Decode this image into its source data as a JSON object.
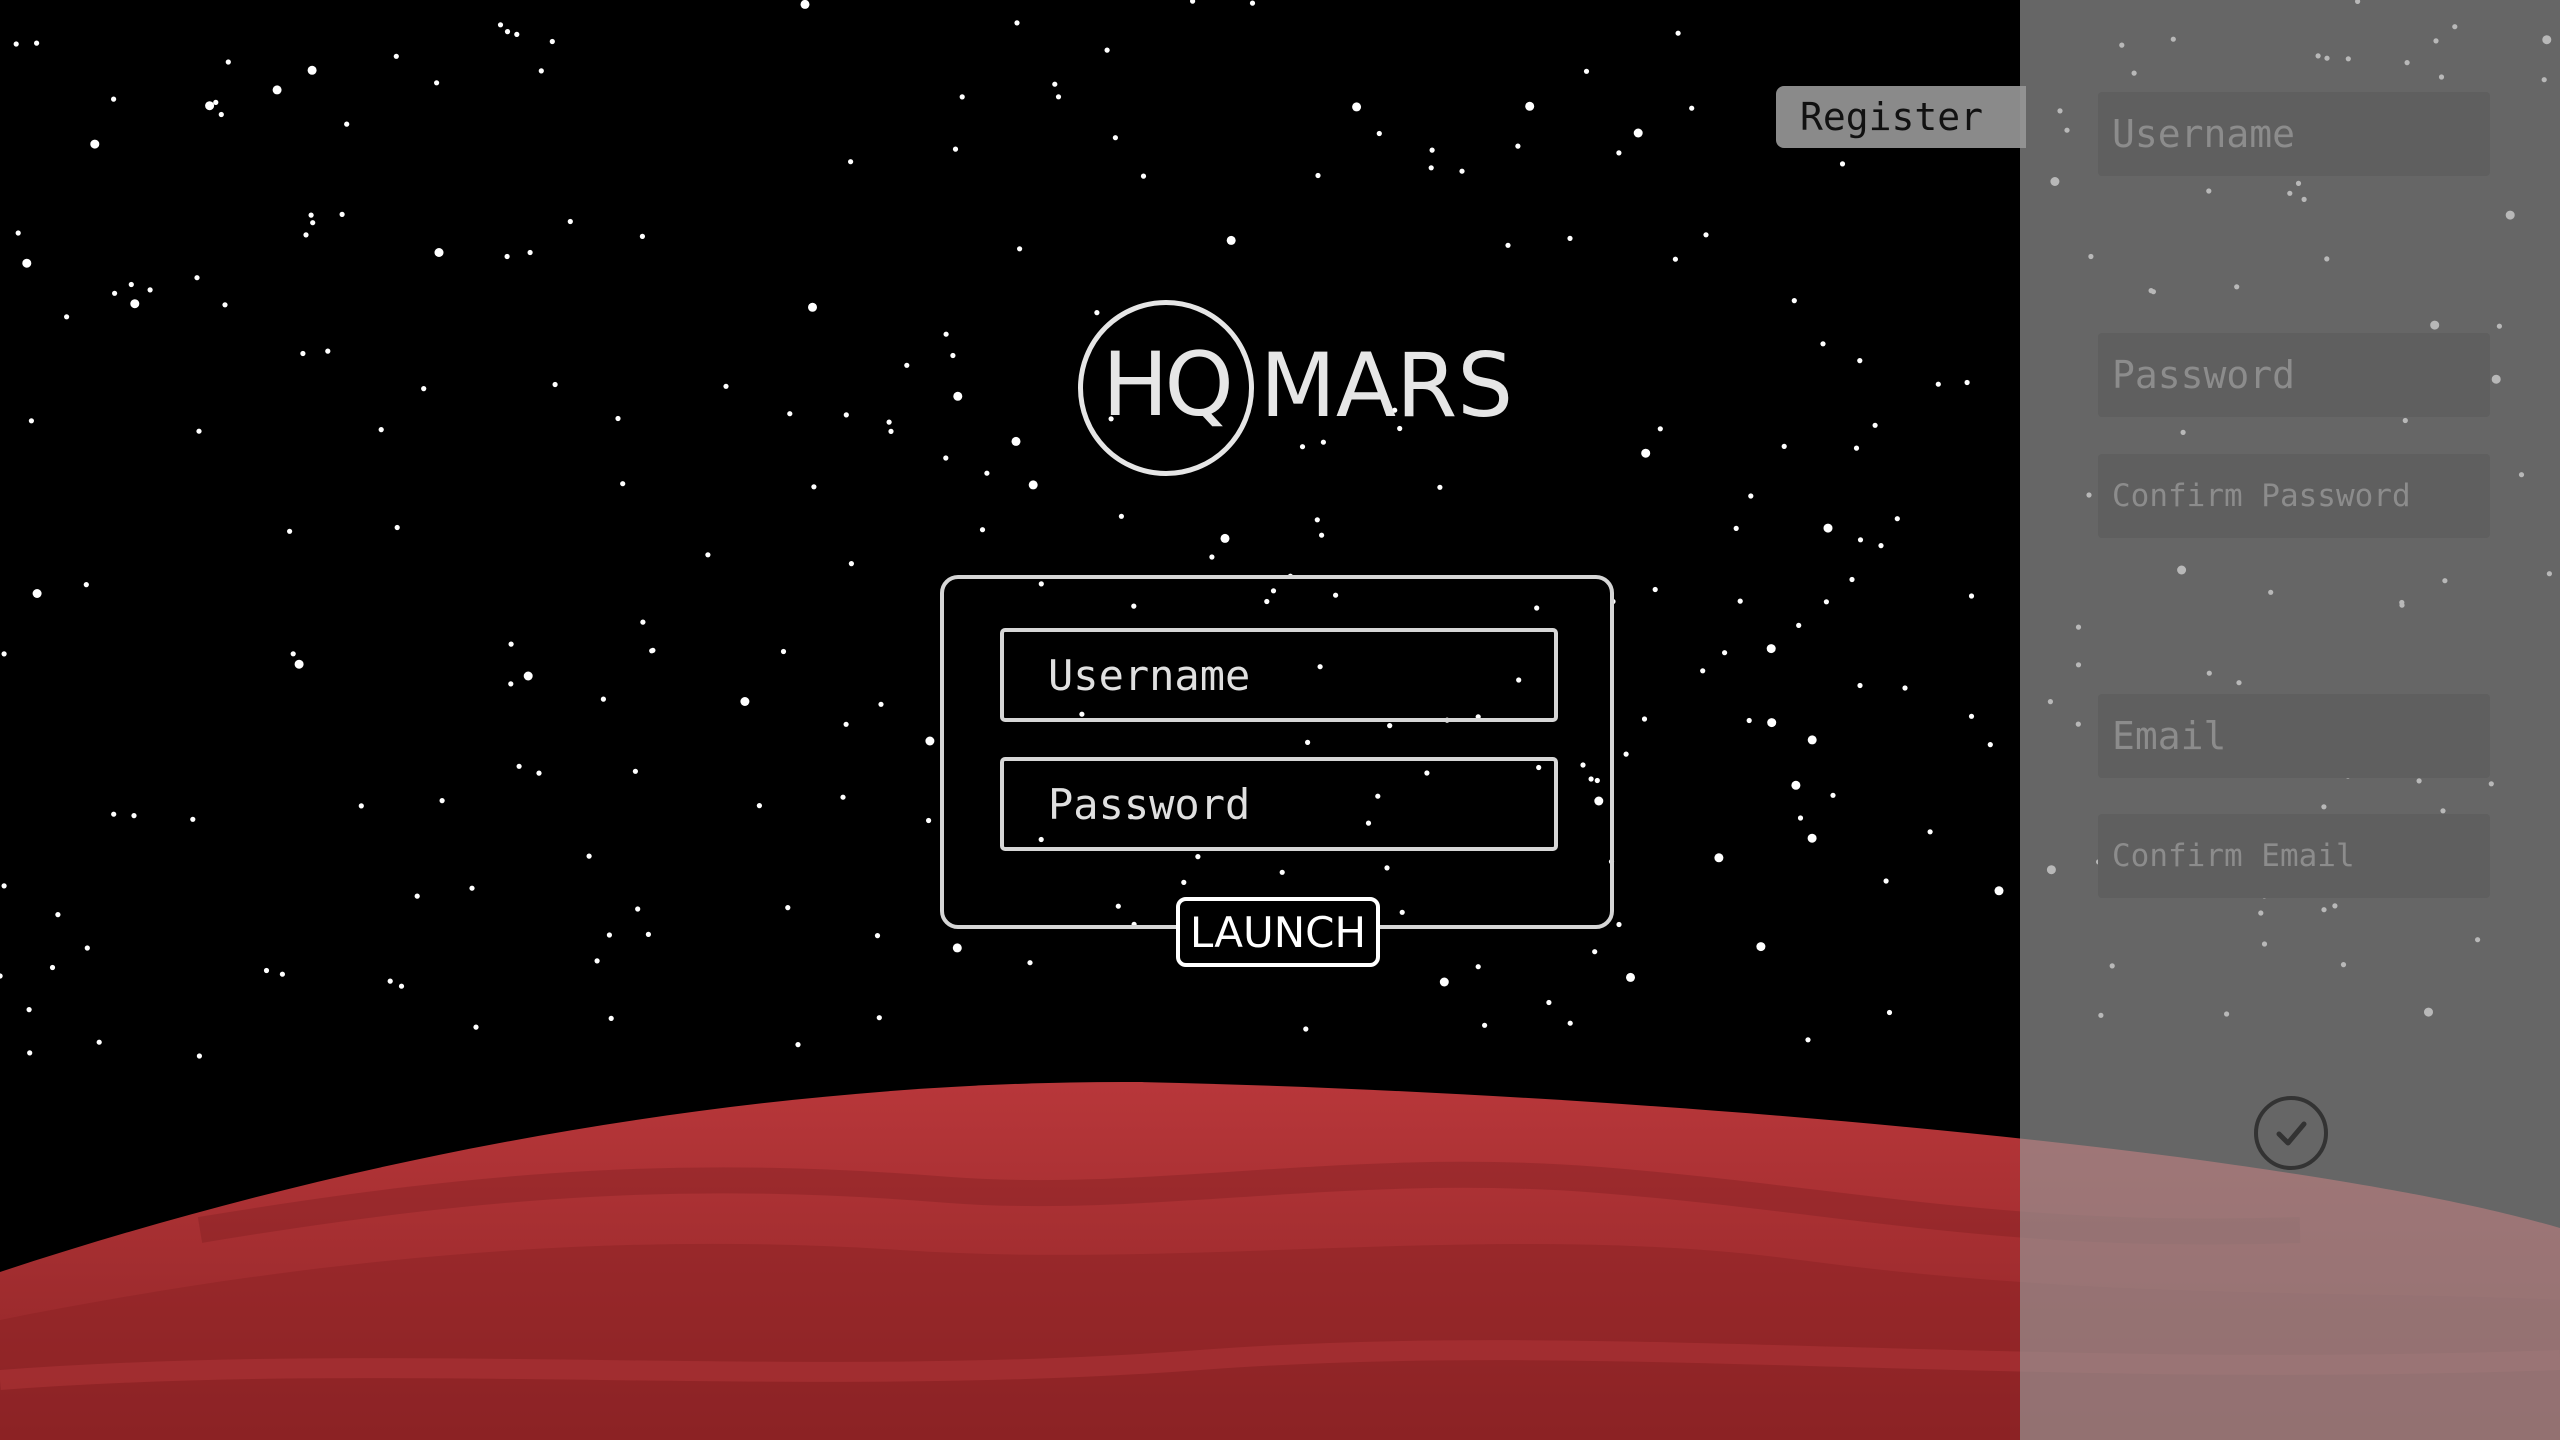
{
  "logo": {
    "hq": "HQ",
    "mars": "MARS"
  },
  "login": {
    "username_placeholder": "Username",
    "password_placeholder": "Password",
    "launch_label": "LAUNCH"
  },
  "register": {
    "tab_label": "Register",
    "username_placeholder": "Username",
    "password_placeholder": "Password",
    "confirm_password_placeholder": "Confirm Password",
    "email_placeholder": "Email",
    "confirm_email_placeholder": "Confirm Email",
    "submit_icon": "checkmark-circle-icon"
  },
  "colors": {
    "background": "#000000",
    "planet": "#c0373a",
    "panel": "#8f8f8f",
    "field": "#5f5f5f",
    "outline": "#d6d6d6"
  }
}
